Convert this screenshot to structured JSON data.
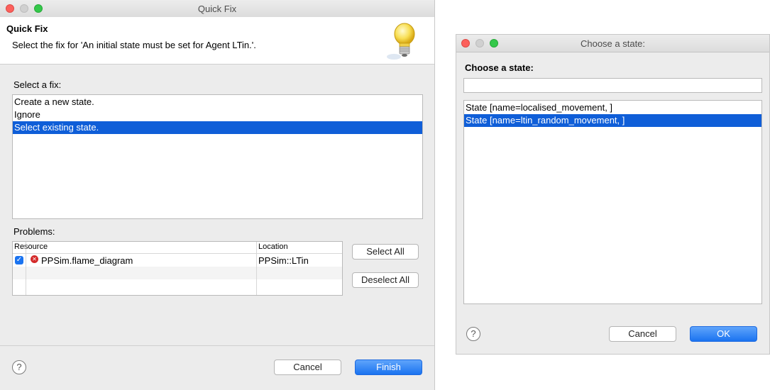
{
  "quick_fix": {
    "window_title": "Quick Fix",
    "header_title": "Quick Fix",
    "header_message": "Select the fix for 'An initial state must be set for Agent LTin.'.",
    "select_fix_label": "Select a fix:",
    "fixes": [
      "Create a new state.",
      "Ignore",
      "Select existing state."
    ],
    "selected_fix_index": 2,
    "problems_label": "Problems:",
    "columns": [
      "Resource",
      "Location"
    ],
    "rows": [
      {
        "checked": true,
        "resource": "PPSim.flame_diagram",
        "location": "PPSim::LTin",
        "icon": "error-icon"
      }
    ],
    "select_all_label": "Select All",
    "deselect_all_label": "Deselect All",
    "cancel_label": "Cancel",
    "finish_label": "Finish",
    "help_glyph": "?",
    "header_icon": "lightbulb-icon"
  },
  "choose_state": {
    "window_title": "Choose a state:",
    "prompt_label": "Choose a state:",
    "filter_value": "",
    "states": [
      "State [name=localised_movement, ]",
      "State [name=ltin_random_movement, ]"
    ],
    "selected_state_index": 1,
    "cancel_label": "Cancel",
    "ok_label": "OK",
    "help_glyph": "?"
  },
  "colors": {
    "selection": "#0f5ed8",
    "primary_button": "#1a73f0",
    "window_bg": "#ececec"
  }
}
